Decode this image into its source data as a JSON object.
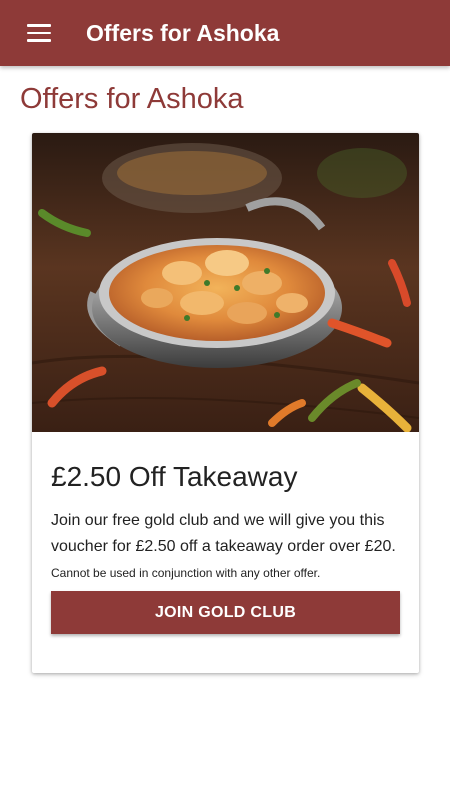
{
  "app_bar": {
    "menu_icon": "hamburger-menu-icon",
    "title": "Offers for Ashoka",
    "background_color": "#8e3a38"
  },
  "page": {
    "title": "Offers for Ashoka"
  },
  "offer_card": {
    "image": "chicken-curry-in-balti-dish-with-chillies",
    "title": "£2.50 Off Takeaway",
    "description": "Join our free gold club and we will give you this voucher for £2.50 off a takeaway order over £20.",
    "terms": "Cannot be used in conjunction with any other offer.",
    "button_label": "JOIN GOLD CLUB"
  }
}
